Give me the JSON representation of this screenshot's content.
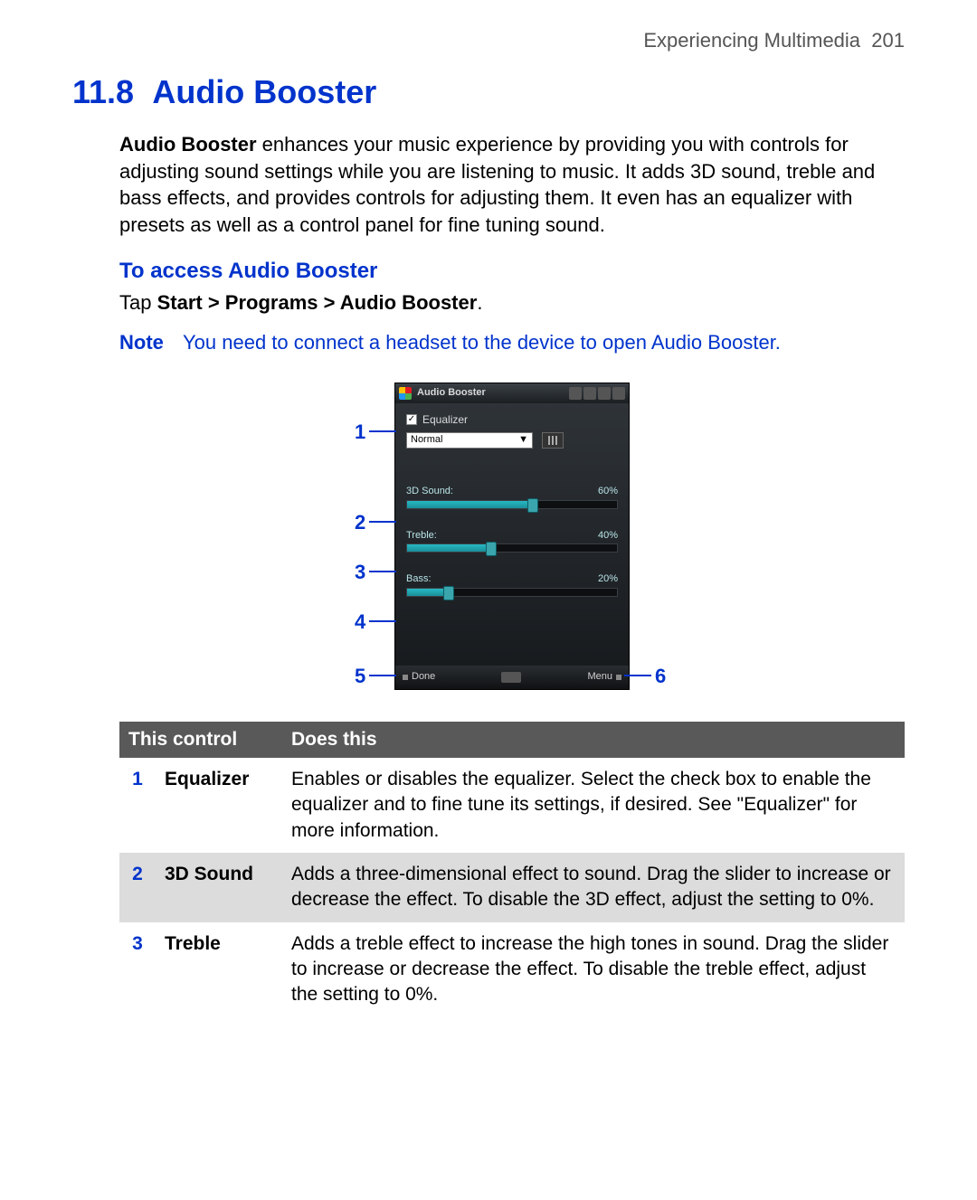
{
  "header": {
    "chapter": "Experiencing Multimedia",
    "page_num": "201"
  },
  "section": {
    "number": "11.8",
    "title": "Audio Booster"
  },
  "intro": {
    "lead_bold": "Audio Booster",
    "rest": " enhances your music experience by providing you with controls for adjusting sound settings while you are listening to music. It adds 3D sound, treble and bass effects, and provides controls for adjusting them. It even has an equalizer with presets as well as a control panel for fine tuning sound."
  },
  "access": {
    "heading": "To access Audio Booster",
    "tap_prefix": "Tap ",
    "tap_path": "Start > Programs > Audio Booster",
    "tap_suffix": "."
  },
  "note": {
    "label": "Note",
    "text": "You need to connect a headset to the device to open Audio Booster."
  },
  "phone": {
    "title": "Audio Booster",
    "equalizer_label": "Equalizer",
    "dropdown_value": "Normal",
    "sliders": {
      "sound3d": {
        "label": "3D Sound:",
        "value": "60%",
        "pct": 60
      },
      "treble": {
        "label": "Treble:",
        "value": "40%",
        "pct": 40
      },
      "bass": {
        "label": "Bass:",
        "value": "20%",
        "pct": 20
      }
    },
    "soft_left": "Done",
    "soft_right": "Menu"
  },
  "callouts": {
    "c1": "1",
    "c2": "2",
    "c3": "3",
    "c4": "4",
    "c5": "5",
    "c6": "6"
  },
  "table": {
    "th1": "This control",
    "th2": "Does this",
    "rows": [
      {
        "n": "1",
        "name": "Equalizer",
        "desc": "Enables or disables the equalizer. Select the check box to enable the equalizer and to fine tune its settings, if desired. See \"Equalizer\" for more information."
      },
      {
        "n": "2",
        "name": "3D Sound",
        "desc": "Adds a three-dimensional effect to sound. Drag the slider to increase or decrease the effect. To disable the 3D effect, adjust the setting to 0%."
      },
      {
        "n": "3",
        "name": "Treble",
        "desc": "Adds a treble effect to increase the high tones in sound. Drag the slider to increase or decrease the effect. To disable the treble effect, adjust the setting to 0%."
      }
    ]
  }
}
